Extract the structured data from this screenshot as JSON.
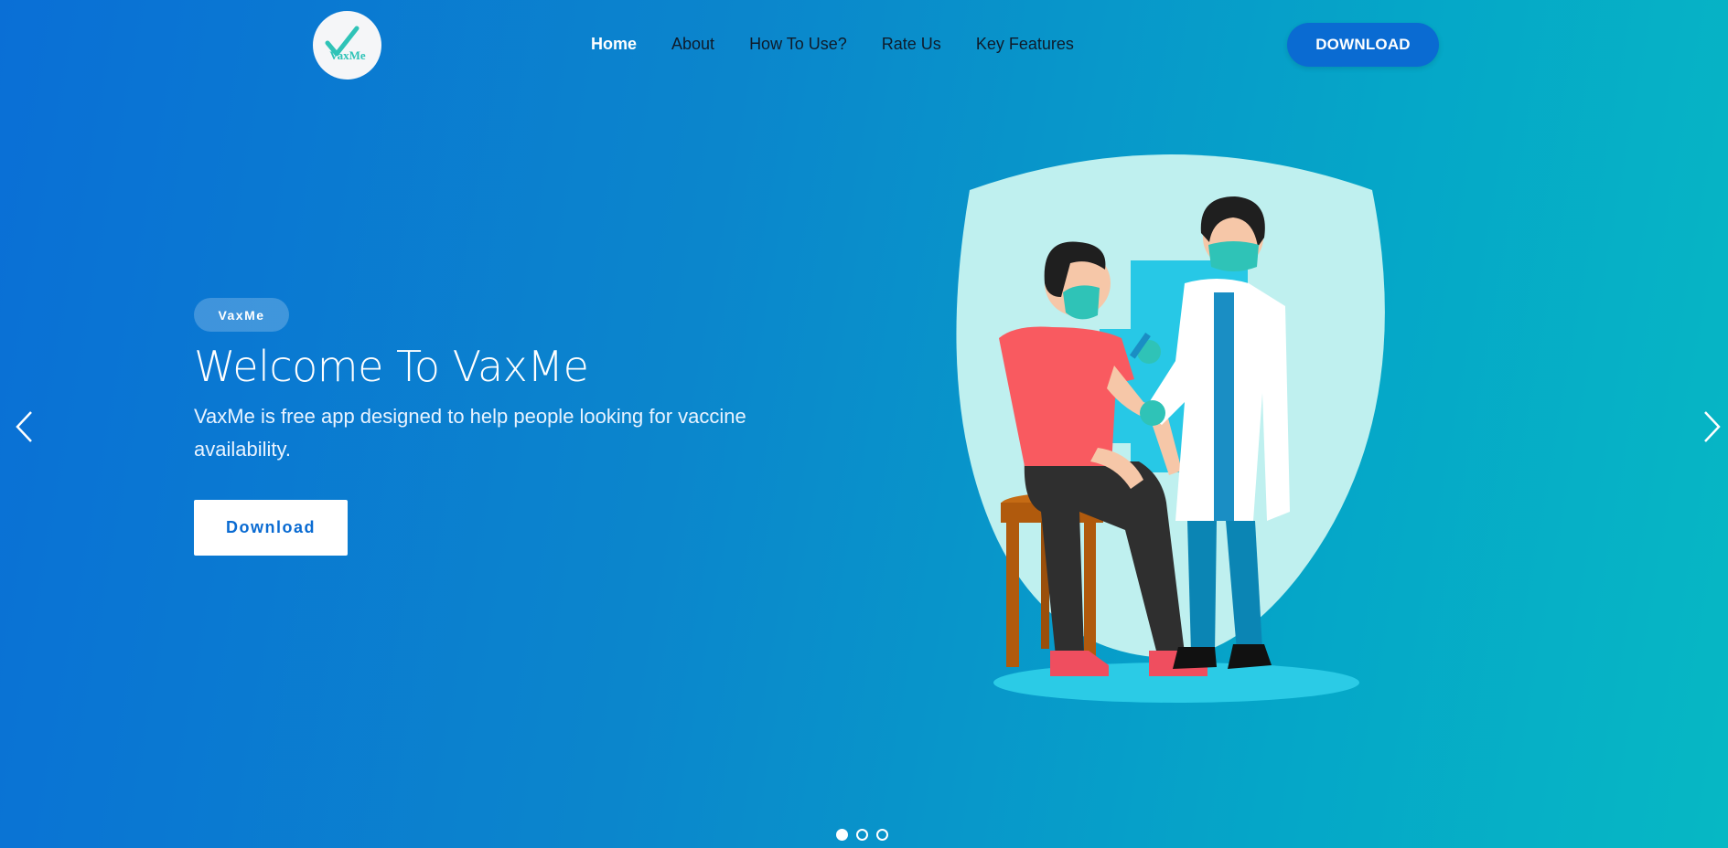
{
  "brand": {
    "logo_text": "VaxMe",
    "check_color": "#2fc3b7"
  },
  "nav": {
    "items": [
      {
        "label": "Home",
        "active": true
      },
      {
        "label": "About"
      },
      {
        "label": "How To Use?"
      },
      {
        "label": "Rate Us"
      },
      {
        "label": "Key Features"
      }
    ],
    "download_label": "DOWNLOAD"
  },
  "hero": {
    "badge": "VaxMe",
    "title": "Welcome To VaxMe",
    "subtitle": "VaxMe is free app designed to help people looking for vaccine availability.",
    "button_label": "Download"
  },
  "carousel": {
    "prev_icon": "chevron-left-icon",
    "next_icon": "chevron-right-icon",
    "slide_count": 3,
    "active_slide": 1
  },
  "colors": {
    "gradient_start": "#0a6fd6",
    "gradient_end": "#06b8c4",
    "button_blue": "#0a6bd2"
  }
}
